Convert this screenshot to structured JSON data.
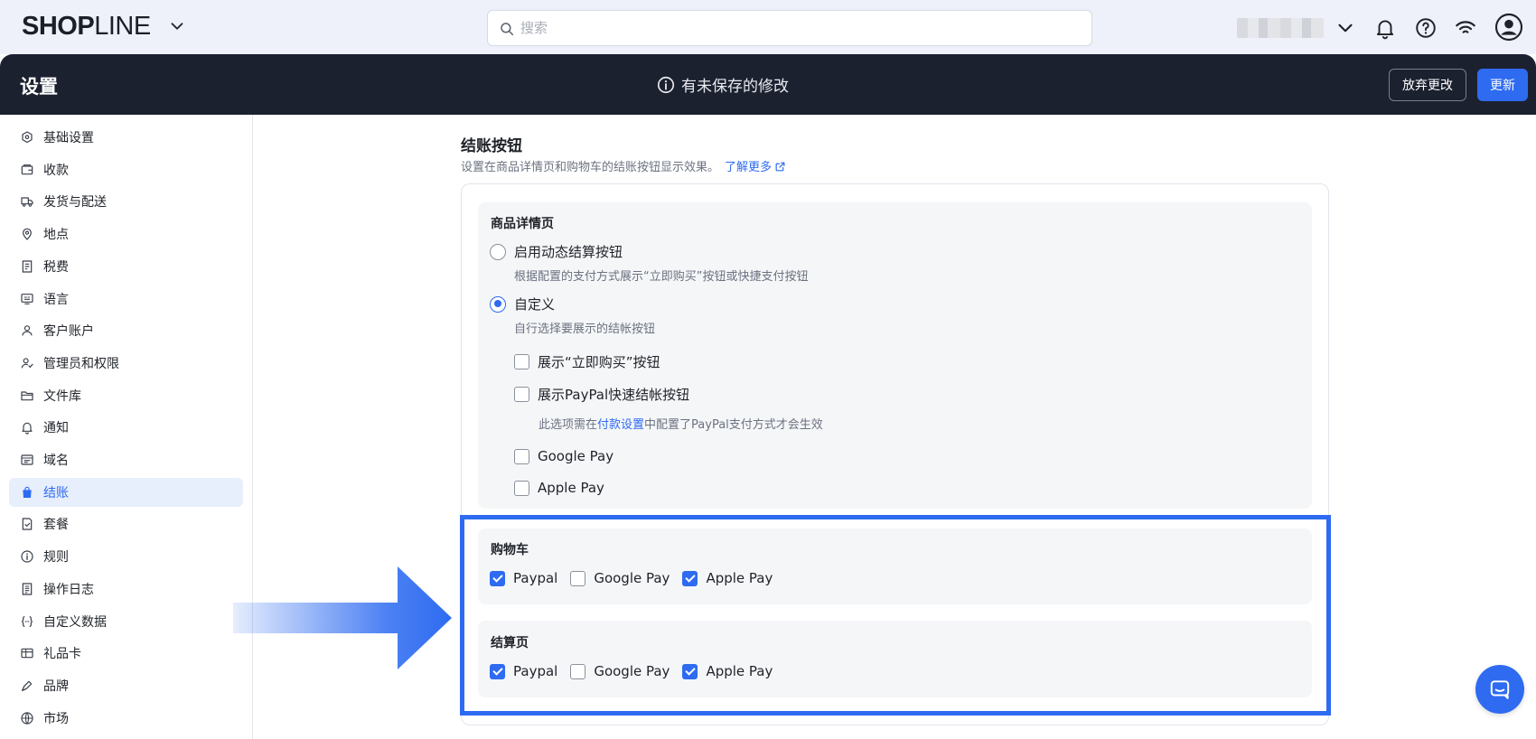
{
  "brand": {
    "logo_bold": "SHOP",
    "logo_thin": "LINE"
  },
  "search": {
    "placeholder": "搜索"
  },
  "header": {
    "title": "设置",
    "unsaved": "有未保存的修改",
    "discard_label": "放弃更改",
    "update_label": "更新"
  },
  "colors": {
    "accent": "#2e6bf1",
    "dark_header": "#1c2130",
    "top_bg": "#eef1f9"
  },
  "sidebar": {
    "items": [
      {
        "label": "基础设置",
        "icon": "settings-hex-icon"
      },
      {
        "label": "收款",
        "icon": "wallet-icon"
      },
      {
        "label": "发货与配送",
        "icon": "truck-icon"
      },
      {
        "label": "地点",
        "icon": "pin-icon"
      },
      {
        "label": "税费",
        "icon": "receipt-icon"
      },
      {
        "label": "语言",
        "icon": "language-icon"
      },
      {
        "label": "客户账户",
        "icon": "user-icon"
      },
      {
        "label": "管理员和权限",
        "icon": "admin-icon"
      },
      {
        "label": "文件库",
        "icon": "folder-icon"
      },
      {
        "label": "通知",
        "icon": "bell-icon"
      },
      {
        "label": "域名",
        "icon": "domain-icon"
      },
      {
        "label": "结账",
        "icon": "bag-icon",
        "active": true
      },
      {
        "label": "套餐",
        "icon": "plan-icon"
      },
      {
        "label": "规则",
        "icon": "info-icon"
      },
      {
        "label": "操作日志",
        "icon": "log-icon"
      },
      {
        "label": "自定义数据",
        "icon": "braces-icon"
      },
      {
        "label": "礼品卡",
        "icon": "gift-card-icon"
      },
      {
        "label": "品牌",
        "icon": "brand-icon"
      },
      {
        "label": "市场",
        "icon": "globe-icon"
      }
    ]
  },
  "section": {
    "title": "结账按钮",
    "desc": "设置在商品详情页和购物车的结账按钮显示效果。",
    "learn_more": "了解更多"
  },
  "product_page": {
    "title": "商品详情页",
    "option_dynamic": {
      "label": "启用动态结算按钮",
      "hint": "根据配置的支付方式展示“立即购买”按钮或快捷支付按钮",
      "selected": false
    },
    "option_custom": {
      "label": "自定义",
      "hint": "自行选择要展示的结帐按钮",
      "selected": true
    },
    "checks": [
      {
        "label": "展示“立即购买”按钮",
        "checked": false
      },
      {
        "label": "展示PayPal快速结帐按钮",
        "checked": false
      },
      {
        "label": "Google Pay",
        "checked": false
      },
      {
        "label": "Apple Pay",
        "checked": false
      }
    ],
    "paypal_hint_pre": "此选项需在",
    "paypal_hint_link": "付款设置",
    "paypal_hint_post": "中配置了PayPal支付方式才会生效"
  },
  "cart": {
    "title": "购物车",
    "options": [
      {
        "label": "Paypal",
        "checked": true
      },
      {
        "label": "Google Pay",
        "checked": false
      },
      {
        "label": "Apple Pay",
        "checked": true
      }
    ]
  },
  "checkout_page": {
    "title": "结算页",
    "options": [
      {
        "label": "Paypal",
        "checked": true
      },
      {
        "label": "Google Pay",
        "checked": false
      },
      {
        "label": "Apple Pay",
        "checked": true
      }
    ]
  }
}
